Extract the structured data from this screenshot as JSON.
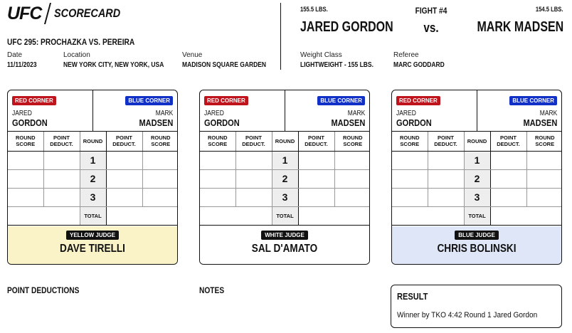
{
  "header": {
    "logo_text": "UFC",
    "title": "SCORECARD",
    "event_name": "UFC 295: PROCHAZKA VS. PEREIRA",
    "date_label": "Date",
    "date": "11/11/2023",
    "location_label": "Location",
    "location": "NEW YORK CITY, NEW YORK, USA",
    "venue_label": "Venue",
    "venue": "MADISON SQUARE GARDEN",
    "weight_class_label": "Weight Class",
    "weight_class": "LIGHTWEIGHT - 155 LBS.",
    "referee_label": "Referee",
    "referee": "MARC GODDARD"
  },
  "fight": {
    "number": "FIGHT #4",
    "vs": "vs.",
    "red_fighter": "JARED GORDON",
    "red_weight": "155.5 LBS.",
    "blue_fighter": "MARK MADSEN",
    "blue_weight": "154.5 LBS."
  },
  "cards": [
    {
      "red_label": "RED CORNER",
      "red_first": "JARED",
      "red_last": "GORDON",
      "blue_label": "BLUE CORNER",
      "blue_first": "MARK",
      "blue_last": "MADSEN",
      "headers": [
        "ROUND SCORE",
        "POINT DEDUCT.",
        "ROUND",
        "POINT DEDUCT.",
        "ROUND SCORE"
      ],
      "rounds": [
        "1",
        "2",
        "3"
      ],
      "total_label": "TOTAL",
      "judge_label": "YELLOW JUDGE",
      "judge_name": "DAVE TIRELLI",
      "judge_color": "#faf3c8"
    },
    {
      "red_label": "RED CORNER",
      "red_first": "JARED",
      "red_last": "GORDON",
      "blue_label": "BLUE CORNER",
      "blue_first": "MARK",
      "blue_last": "MADSEN",
      "headers": [
        "ROUND SCORE",
        "POINT DEDUCT.",
        "ROUND",
        "POINT DEDUCT.",
        "ROUND SCORE"
      ],
      "rounds": [
        "1",
        "2",
        "3"
      ],
      "total_label": "TOTAL",
      "judge_label": "WHITE JUDGE",
      "judge_name": "SAL D'AMATO",
      "judge_color": "#ffffff"
    },
    {
      "red_label": "RED CORNER",
      "red_first": "JARED",
      "red_last": "GORDON",
      "blue_label": "BLUE CORNER",
      "blue_first": "MARK",
      "blue_last": "MADSEN",
      "headers": [
        "ROUND SCORE",
        "POINT DEDUCT.",
        "ROUND",
        "POINT DEDUCT.",
        "ROUND SCORE"
      ],
      "rounds": [
        "1",
        "2",
        "3"
      ],
      "total_label": "TOTAL",
      "judge_label": "BLUE JUDGE",
      "judge_name": "CHRIS BOLINSKI",
      "judge_color": "#dfe6f8"
    }
  ],
  "footer": {
    "point_deductions_title": "POINT DEDUCTIONS",
    "notes_title": "NOTES",
    "result_title": "RESULT",
    "result_text": "Winner by TKO 4:42 Round 1 Jared Gordon"
  },
  "colors": {
    "red_corner": "#c0141c",
    "blue_corner": "#1030c8"
  }
}
